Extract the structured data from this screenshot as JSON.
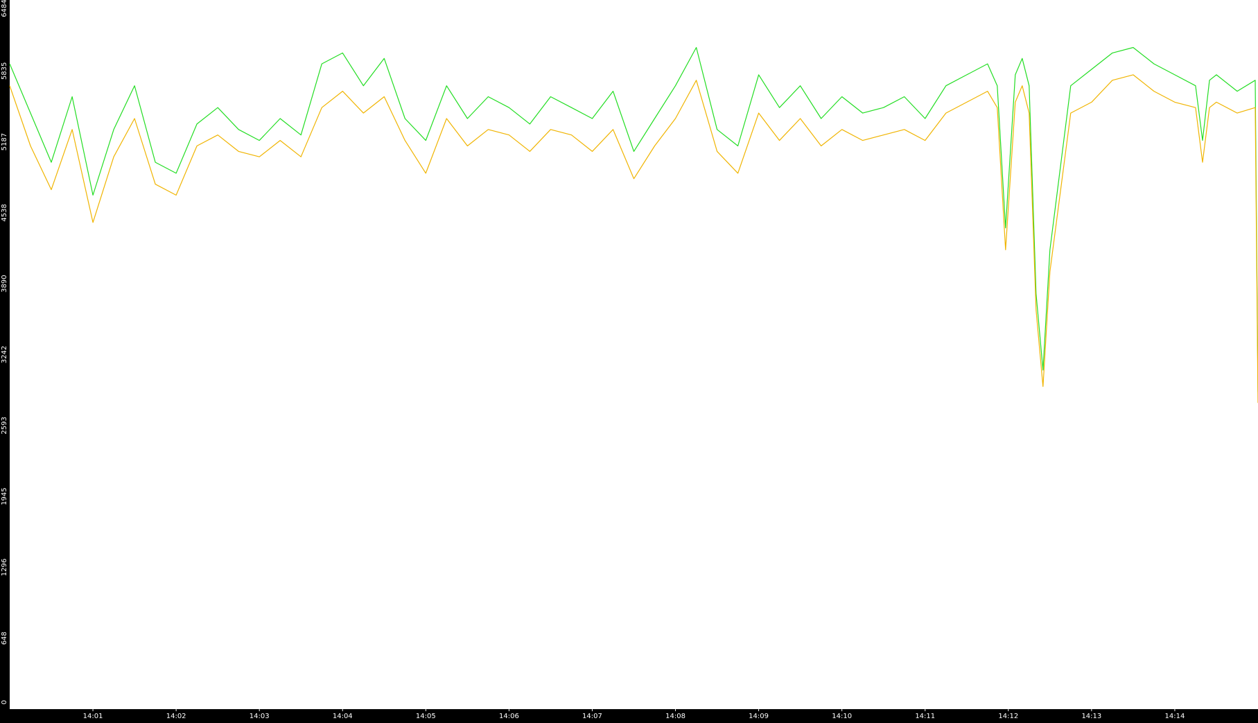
{
  "chart_data": {
    "type": "line",
    "title": "",
    "xlabel": "",
    "ylabel": "",
    "ylim": [
      0,
      6484
    ],
    "y_ticks": [
      0,
      648,
      1296,
      1945,
      2593,
      3242,
      3890,
      4538,
      5187,
      5835,
      6484
    ],
    "x_range": [
      "14:00:00",
      "14:15:00"
    ],
    "x_ticks": [
      "14:01",
      "14:02",
      "14:03",
      "14:04",
      "14:05",
      "14:06",
      "14:07",
      "14:08",
      "14:09",
      "14:10",
      "14:11",
      "14:12",
      "14:13",
      "14:14"
    ],
    "grid": false,
    "legend": "none",
    "series": [
      {
        "color": "#22dd22",
        "x": [
          "14:00:00",
          "14:00:15",
          "14:00:30",
          "14:00:45",
          "14:01:00",
          "14:01:15",
          "14:01:30",
          "14:01:45",
          "14:02:00",
          "14:02:15",
          "14:02:30",
          "14:02:45",
          "14:03:00",
          "14:03:15",
          "14:03:30",
          "14:03:45",
          "14:04:00",
          "14:04:15",
          "14:04:30",
          "14:04:45",
          "14:05:00",
          "14:05:15",
          "14:05:30",
          "14:05:45",
          "14:06:00",
          "14:06:15",
          "14:06:30",
          "14:06:45",
          "14:07:00",
          "14:07:15",
          "14:07:30",
          "14:07:45",
          "14:08:00",
          "14:08:15",
          "14:08:30",
          "14:08:45",
          "14:09:00",
          "14:09:15",
          "14:09:30",
          "14:09:45",
          "14:10:00",
          "14:10:15",
          "14:10:30",
          "14:10:45",
          "14:11:00",
          "14:11:15",
          "14:11:30",
          "14:11:45",
          "14:11:52",
          "14:11:58",
          "14:12:05",
          "14:12:10",
          "14:12:15",
          "14:12:20",
          "14:12:25",
          "14:12:30",
          "14:12:45",
          "14:13:00",
          "14:13:15",
          "14:13:30",
          "14:13:45",
          "14:14:00",
          "14:14:15",
          "14:14:20",
          "14:14:25",
          "14:14:30",
          "14:14:45",
          "14:14:58",
          "14:15:00"
        ],
        "values": [
          5900,
          5450,
          5000,
          5600,
          4700,
          5300,
          5700,
          5000,
          4900,
          5350,
          5500,
          5300,
          5200,
          5400,
          5250,
          5900,
          6000,
          5700,
          5950,
          5400,
          5200,
          5700,
          5400,
          5600,
          5500,
          5350,
          5600,
          5500,
          5400,
          5650,
          5100,
          5400,
          5700,
          6050,
          5300,
          5150,
          5800,
          5500,
          5700,
          5400,
          5600,
          5450,
          5500,
          5600,
          5400,
          5700,
          5800,
          5900,
          5700,
          4400,
          5800,
          5950,
          5700,
          3800,
          3100,
          4200,
          5700,
          5850,
          6000,
          6050,
          5900,
          5800,
          5700,
          5200,
          5750,
          5800,
          5650,
          5750,
          2900
        ]
      },
      {
        "color": "#f0b400",
        "x": [
          "14:00:00",
          "14:00:15",
          "14:00:30",
          "14:00:45",
          "14:01:00",
          "14:01:15",
          "14:01:30",
          "14:01:45",
          "14:02:00",
          "14:02:15",
          "14:02:30",
          "14:02:45",
          "14:03:00",
          "14:03:15",
          "14:03:30",
          "14:03:45",
          "14:04:00",
          "14:04:15",
          "14:04:30",
          "14:04:45",
          "14:05:00",
          "14:05:15",
          "14:05:30",
          "14:05:45",
          "14:06:00",
          "14:06:15",
          "14:06:30",
          "14:06:45",
          "14:07:00",
          "14:07:15",
          "14:07:30",
          "14:07:45",
          "14:08:00",
          "14:08:15",
          "14:08:30",
          "14:08:45",
          "14:09:00",
          "14:09:15",
          "14:09:30",
          "14:09:45",
          "14:10:00",
          "14:10:15",
          "14:10:30",
          "14:10:45",
          "14:11:00",
          "14:11:15",
          "14:11:30",
          "14:11:45",
          "14:11:52",
          "14:11:58",
          "14:12:05",
          "14:12:10",
          "14:12:15",
          "14:12:20",
          "14:12:25",
          "14:12:30",
          "14:12:45",
          "14:13:00",
          "14:13:15",
          "14:13:30",
          "14:13:45",
          "14:14:00",
          "14:14:15",
          "14:14:20",
          "14:14:25",
          "14:14:30",
          "14:14:45",
          "14:14:58",
          "14:15:00"
        ],
        "values": [
          5700,
          5150,
          4750,
          5300,
          4450,
          5050,
          5400,
          4800,
          4700,
          5150,
          5250,
          5100,
          5050,
          5200,
          5050,
          5500,
          5650,
          5450,
          5600,
          5200,
          4900,
          5400,
          5150,
          5300,
          5250,
          5100,
          5300,
          5250,
          5100,
          5300,
          4850,
          5150,
          5400,
          5750,
          5100,
          4900,
          5450,
          5200,
          5400,
          5150,
          5300,
          5200,
          5250,
          5300,
          5200,
          5450,
          5550,
          5650,
          5500,
          4200,
          5550,
          5700,
          5450,
          3650,
          2950,
          4000,
          5450,
          5550,
          5750,
          5800,
          5650,
          5550,
          5500,
          5000,
          5500,
          5550,
          5450,
          5500,
          2800
        ]
      }
    ]
  }
}
